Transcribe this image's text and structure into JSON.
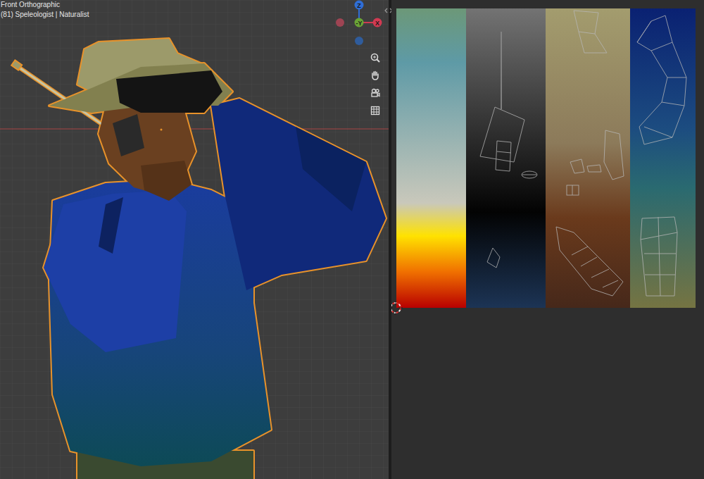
{
  "viewport": {
    "view": "Front Orthographic",
    "object": "(81) Speleologist | Naturalist"
  },
  "gizmo": {
    "axes": [
      {
        "label": "Z",
        "color": "#2f6ed6"
      },
      {
        "label": "-Y",
        "color": "#6aa336"
      },
      {
        "label": "X",
        "color": "#d13a52"
      }
    ],
    "negative_axes": [
      {
        "color": "#9e4453"
      },
      {
        "color": "#2f5c9c"
      }
    ]
  }
}
